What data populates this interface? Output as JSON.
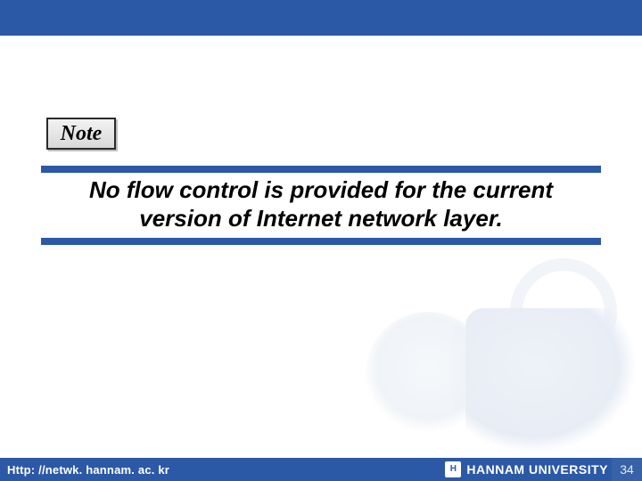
{
  "note": {
    "label": "Note"
  },
  "callout": {
    "text": "No flow control is provided for the current version of Internet network layer."
  },
  "footer": {
    "url": "Http: //netwk. hannam. ac. kr",
    "logo_mark": "H",
    "university": "HANNAM  UNIVERSITY",
    "page": "34"
  }
}
